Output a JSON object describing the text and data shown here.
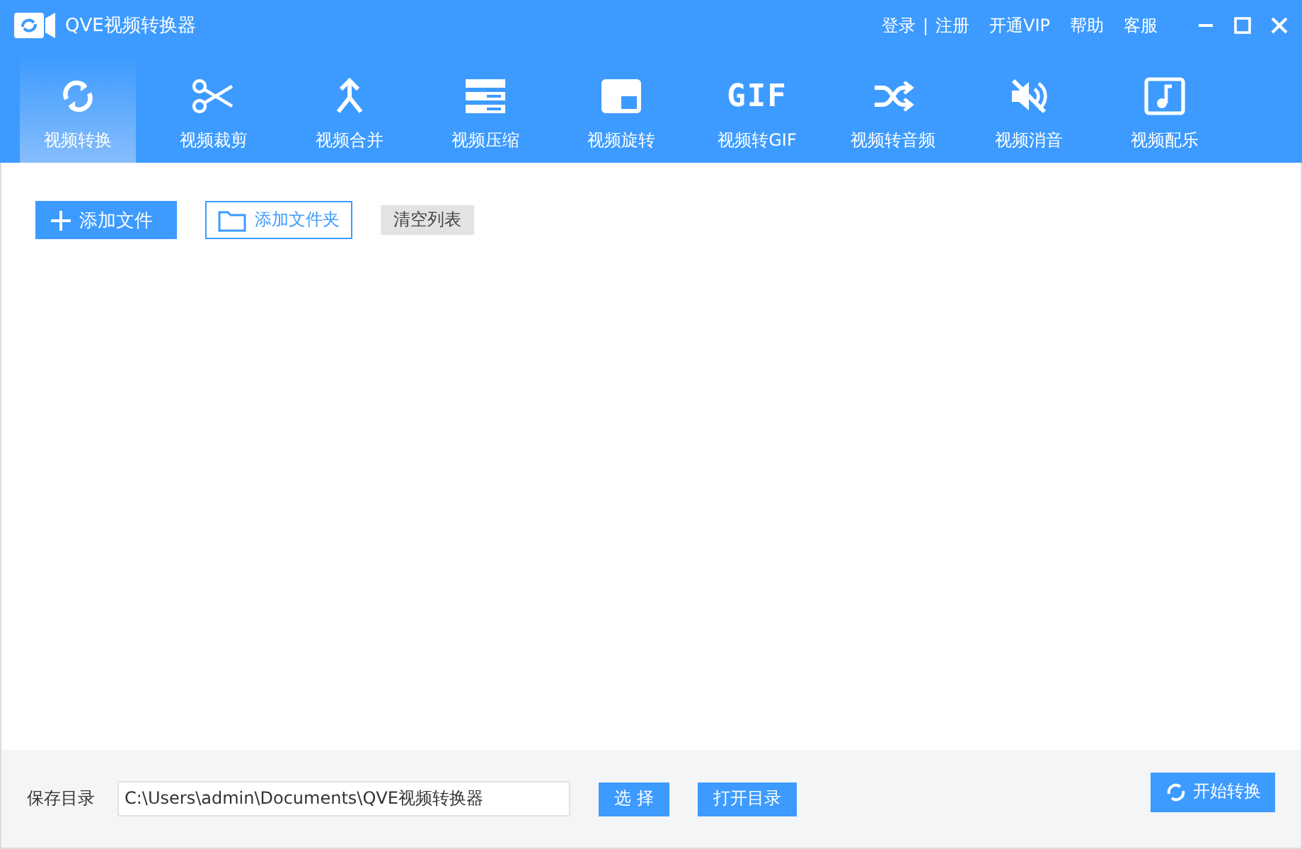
{
  "window": {
    "title": "QVE视频转换器"
  },
  "header_links": [
    {
      "label": "登录",
      "kind": "link"
    },
    {
      "label": "|",
      "kind": "separator"
    },
    {
      "label": "注册",
      "kind": "link"
    },
    {
      "label": "开通VIP",
      "kind": "link"
    },
    {
      "label": "帮助",
      "kind": "link"
    },
    {
      "label": "客服",
      "kind": "link"
    }
  ],
  "tools": [
    {
      "label": "视频转换",
      "kind": "convert",
      "selected": true
    },
    {
      "label": "视频裁剪",
      "kind": "cut",
      "selected": false
    },
    {
      "label": "视频合并",
      "kind": "merge",
      "selected": false
    },
    {
      "label": "视频压缩",
      "kind": "compress",
      "selected": false
    },
    {
      "label": "视频旋转",
      "kind": "rotate",
      "selected": false
    },
    {
      "label": "视频转GIF",
      "kind": "gif",
      "icon_text": "GIF",
      "selected": false
    },
    {
      "label": "视频转音频",
      "kind": "shuffle",
      "selected": false
    },
    {
      "label": "视频消音",
      "kind": "mute",
      "selected": false
    },
    {
      "label": "视频配乐",
      "kind": "music",
      "selected": false
    }
  ],
  "actions": [
    {
      "label": "添加文件",
      "kind": "primary"
    },
    {
      "label": "添加文件夹",
      "kind": "outline"
    },
    {
      "label": "清空列表",
      "kind": "gray"
    }
  ],
  "footer": {
    "label": "保存目录",
    "path": "C:\\Users\\admin\\Documents\\QVE视频转换器",
    "buttons": [
      "选 择",
      "打开目录"
    ],
    "start": "开始转换"
  }
}
